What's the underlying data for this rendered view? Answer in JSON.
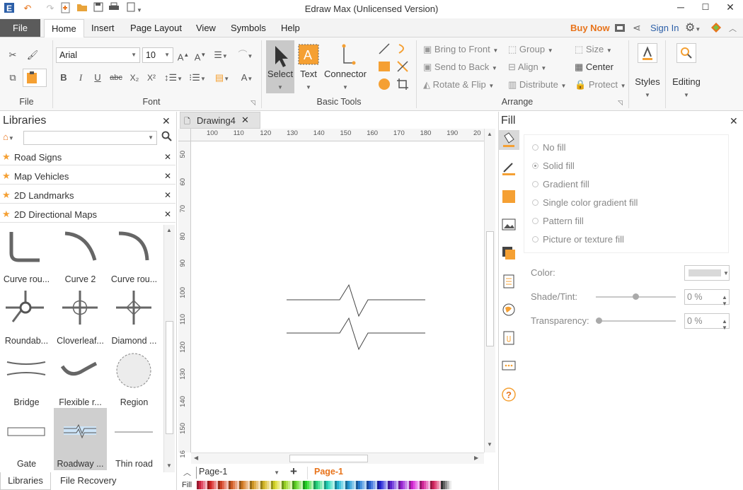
{
  "app": {
    "title": "Edraw Max (Unlicensed Version)"
  },
  "menu": {
    "file": "File",
    "tabs": [
      "Home",
      "Insert",
      "Page Layout",
      "View",
      "Symbols",
      "Help"
    ],
    "buy_now": "Buy Now",
    "sign_in": "Sign In"
  },
  "ribbon": {
    "file_group": "File",
    "font": {
      "family": "Arial",
      "size": "10",
      "group": "Font"
    },
    "basic_tools": {
      "select": "Select",
      "text": "Text",
      "connector": "Connector",
      "group": "Basic Tools"
    },
    "arrange": {
      "bring_to_front": "Bring to Front",
      "send_to_back": "Send to Back",
      "rotate_flip": "Rotate & Flip",
      "group": "Group",
      "align": "Align",
      "distribute": "Distribute",
      "size": "Size",
      "center": "Center",
      "protect": "Protect",
      "group_label": "Arrange"
    },
    "styles": "Styles",
    "editing": "Editing"
  },
  "libraries": {
    "title": "Libraries",
    "categories": [
      "Road Signs",
      "Map Vehicles",
      "2D Landmarks",
      "2D Directional Maps"
    ],
    "shapes": [
      "Curve rou...",
      "Curve 2",
      "Curve rou...",
      "Roundab...",
      "Cloverleaf...",
      "Diamond ...",
      "Bridge",
      "Flexible r...",
      "Region",
      "Gate",
      "Roadway ...",
      "Thin road"
    ],
    "bottom_tabs": [
      "Libraries",
      "File Recovery"
    ]
  },
  "document": {
    "tab": "Drawing4",
    "hruler": [
      "100",
      "110",
      "120",
      "130",
      "140",
      "150",
      "160",
      "170",
      "180",
      "190",
      "20"
    ],
    "vruler": [
      "50",
      "60",
      "70",
      "80",
      "90",
      "100",
      "110",
      "120",
      "130",
      "140",
      "150",
      "16"
    ],
    "page_select": "Page-1",
    "page_tab": "Page-1",
    "fill_label": "Fill"
  },
  "fill": {
    "title": "Fill",
    "options": [
      "No fill",
      "Solid fill",
      "Gradient fill",
      "Single color gradient fill",
      "Pattern fill",
      "Picture or texture fill"
    ],
    "color_label": "Color:",
    "shade_label": "Shade/Tint:",
    "shade_value": "0 %",
    "transparency_label": "Transparency:",
    "transparency_value": "0 %"
  },
  "colors": {
    "accent": "#e8731a",
    "toolicon": "#f5a033",
    "menubar": "#f3f3f3",
    "selected": "#c9c9c9"
  }
}
